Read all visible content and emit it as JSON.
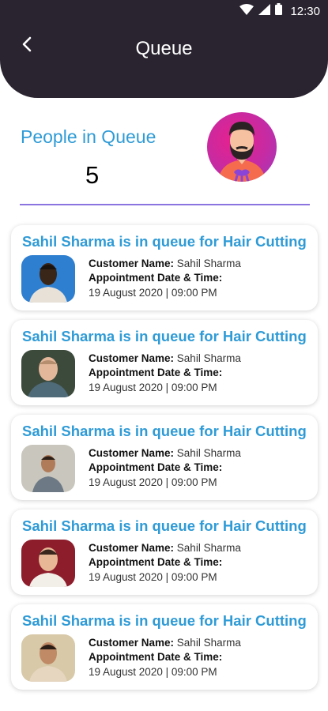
{
  "status_bar": {
    "time": "12:30"
  },
  "header": {
    "title": "Queue"
  },
  "summary": {
    "label": "People in Queue",
    "count": "5"
  },
  "queue": [
    {
      "title": "Sahil Sharma is in queue for Hair Cutting",
      "customer_label": "Customer Name:",
      "customer_name": "Sahil Sharma",
      "appointment_label": "Appointment Date & Time:",
      "appointment_value": "19 August 2020 | 09:00 PM"
    },
    {
      "title": "Sahil Sharma is in queue for Hair Cutting",
      "customer_label": "Customer Name:",
      "customer_name": "Sahil Sharma",
      "appointment_label": "Appointment Date & Time:",
      "appointment_value": "19 August 2020 | 09:00 PM"
    },
    {
      "title": "Sahil Sharma is in queue for Hair Cutting",
      "customer_label": "Customer Name:",
      "customer_name": "Sahil Sharma",
      "appointment_label": "Appointment Date & Time:",
      "appointment_value": "19 August 2020 | 09:00 PM"
    },
    {
      "title": "Sahil Sharma is in queue for Hair Cutting",
      "customer_label": "Customer Name:",
      "customer_name": "Sahil Sharma",
      "appointment_label": "Appointment Date & Time:",
      "appointment_value": "19 August 2020 | 09:00 PM"
    },
    {
      "title": "Sahil Sharma is in queue for Hair Cutting",
      "customer_label": "Customer Name:",
      "customer_name": "Sahil Sharma",
      "appointment_label": "Appointment Date & Time:",
      "appointment_value": "19 August 2020 | 09:00 PM"
    }
  ],
  "colors": {
    "header_bg": "#2a2430",
    "accent_blue": "#2f9bd6",
    "divider": "#8b74e0",
    "avatar_bg": "#c62ba3"
  },
  "icons": [
    "wifi-icon",
    "cellular-signal-icon",
    "battery-icon",
    "back-arrow-icon"
  ]
}
